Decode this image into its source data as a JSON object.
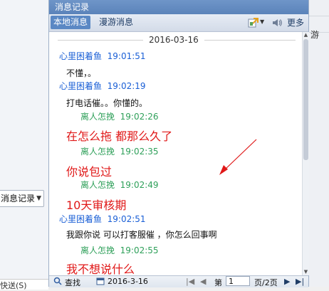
{
  "window": {
    "title": "消息记录"
  },
  "tabs": [
    {
      "label": "本地消息",
      "active": true
    },
    {
      "label": "漫游消息",
      "active": false
    }
  ],
  "toolbar": {
    "more_label": "更多"
  },
  "background": {
    "left_select_label": "消息记录",
    "left_bottom_text": "快送(S)",
    "right_tag": "游"
  },
  "date": "2016-03-16",
  "messages": [
    {
      "sender": "心里困着鱼",
      "time": "19:01:51",
      "text": "不懂，。",
      "color": "blue",
      "style": "normal"
    },
    {
      "sender": "心里困着鱼",
      "time": "19:02:19",
      "text": "打电话催。。你懂的。",
      "color": "blue",
      "style": "normal"
    },
    {
      "sender": "离人怎挽",
      "time": "19:02:26",
      "text": "在怎么拖 都那么久了",
      "color": "green",
      "style": "big-red"
    },
    {
      "sender": "离人怎挽",
      "time": "19:02:35",
      "text": "你说包过",
      "color": "green",
      "style": "big-red"
    },
    {
      "sender": "离人怎挽",
      "time": "19:02:49",
      "text": "10天审核期",
      "color": "green",
      "style": "big-red"
    },
    {
      "sender": "心里困着鱼",
      "time": "19:02:51",
      "text": "我跟你说 可以打客服催 ，你怎么回事啊",
      "color": "blue",
      "style": "normal"
    },
    {
      "sender": "离人怎挽",
      "time": "19:02:55",
      "text": "我不想说什么",
      "color": "green",
      "style": "big-red"
    }
  ],
  "bottom": {
    "search_label": "查找",
    "date_value": "2016-3-16",
    "page_prefix": "第",
    "page_value": "1",
    "page_suffix": "页/2页"
  },
  "colors": {
    "blue": "#1a5fd6",
    "green": "#2fa05a",
    "red": "#e01818",
    "title": "#5b83ba"
  }
}
